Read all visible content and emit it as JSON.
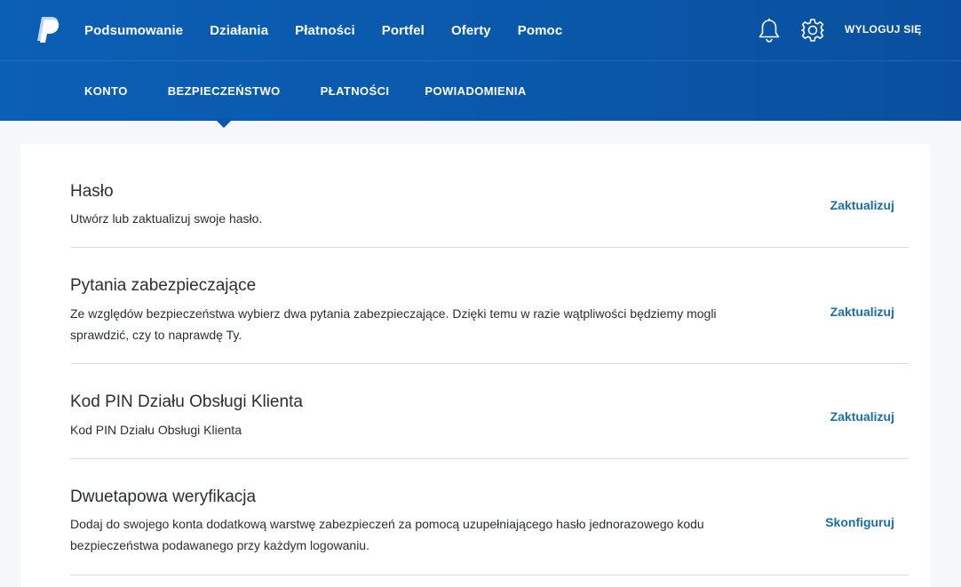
{
  "nav": {
    "items": [
      "Podsumowanie",
      "Działania",
      "Płatności",
      "Portfel",
      "Oferty",
      "Pomoc"
    ],
    "logout": "WYLOGUJ SIĘ",
    "icons": {
      "logo": "paypal-logo-icon",
      "notifications": "bell-icon",
      "settings": "gear-icon"
    }
  },
  "subnav": {
    "items": [
      "KONTO",
      "BEZPIECZEŃSTWO",
      "PŁATNOŚCI",
      "POWIADOMIENIA"
    ],
    "active": "BEZPIECZEŃSTWO"
  },
  "sections": [
    {
      "title": "Hasło",
      "description": "Utwórz lub zaktualizuj swoje hasło.",
      "action": "Zaktualizuj"
    },
    {
      "title": "Pytania zabezpieczające",
      "description": "Ze względów bezpieczeństwa wybierz dwa pytania zabezpieczające. Dzięki temu w razie wątpliwości będziemy mogli sprawdzić, czy to naprawdę Ty.",
      "action": "Zaktualizuj"
    },
    {
      "title": "Kod PIN Działu Obsługi Klienta",
      "description": "Kod PIN Działu Obsługi Klienta",
      "action": "Zaktualizuj"
    },
    {
      "title": "Dwuetapowa weryfikacja",
      "description": "Dodaj do swojego konta dodatkową warstwę zabezpieczeń za pomocą uzupełniającego hasło jednorazowego kodu bezpieczeństwa podawanego przy każdym logowaniu.",
      "action": "Skonfiguruj"
    }
  ],
  "colors": {
    "header": "#0a58ab",
    "link": "#1c6ea8",
    "background": "#f5f7fa"
  }
}
